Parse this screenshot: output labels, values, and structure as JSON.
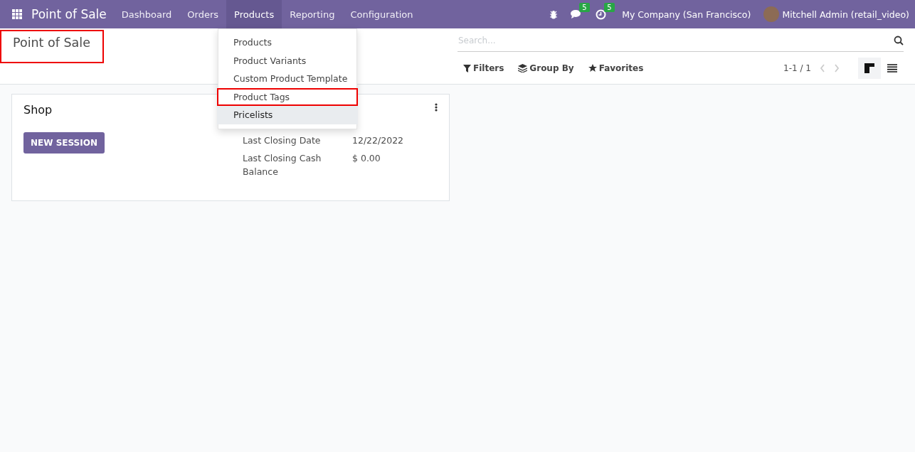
{
  "navbar": {
    "app_name": "Point of Sale",
    "menu": [
      {
        "label": "Dashboard",
        "selected": false
      },
      {
        "label": "Orders",
        "selected": false
      },
      {
        "label": "Products",
        "selected": true
      },
      {
        "label": "Reporting",
        "selected": false
      },
      {
        "label": "Configuration",
        "selected": false
      }
    ],
    "messages_badge": "5",
    "activities_badge": "5",
    "company": "My Company (San Francisco)",
    "user": "Mitchell Admin (retail_video)"
  },
  "dropdown": {
    "items": [
      {
        "label": "Products",
        "hovered": false,
        "highlighted": false
      },
      {
        "label": "Product Variants",
        "hovered": false,
        "highlighted": false
      },
      {
        "label": "Custom Product Template",
        "hovered": false,
        "highlighted": false
      },
      {
        "label": "Product Tags",
        "hovered": false,
        "highlighted": true
      },
      {
        "label": "Pricelists",
        "hovered": true,
        "highlighted": false
      }
    ]
  },
  "control_panel": {
    "title": "Point of Sale",
    "title_highlighted": true,
    "search": {
      "placeholder": "Search..."
    },
    "filters": [
      "Filters",
      "Group By",
      "Favorites"
    ],
    "pager": "1-1 / 1",
    "views": [
      {
        "kind": "kanban",
        "selected": true
      },
      {
        "kind": "list",
        "selected": false
      }
    ]
  },
  "card": {
    "name": "Shop",
    "button": "NEW SESSION",
    "fields": [
      {
        "label": "Last Closing Date",
        "value": "12/22/2022"
      },
      {
        "label": "Last Closing Cash Balance",
        "value": "$ 0.00"
      }
    ]
  }
}
